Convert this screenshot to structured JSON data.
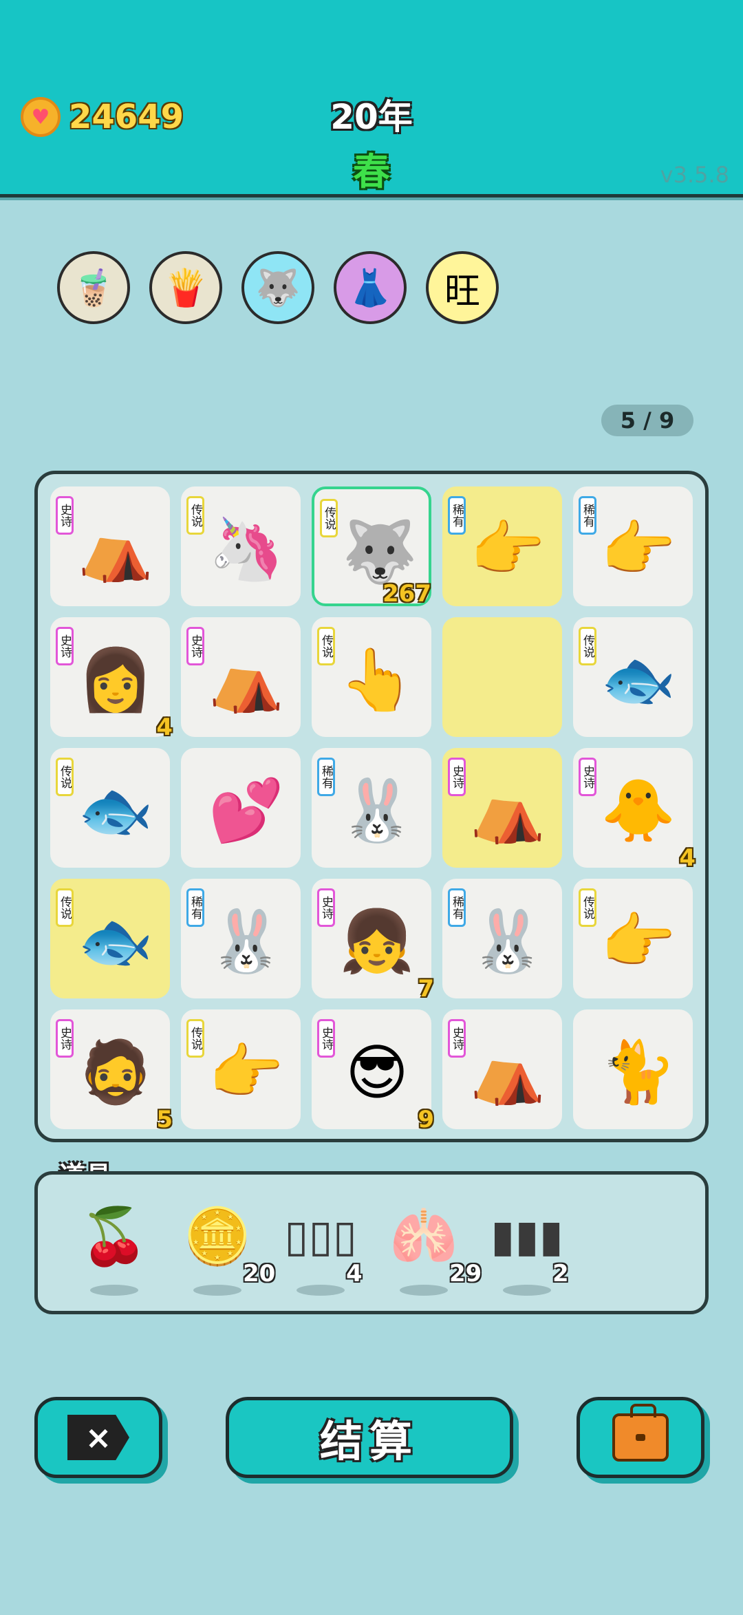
{
  "header": {
    "coins": "24649",
    "year": "20年",
    "season": "春",
    "version": "v3.5.8"
  },
  "slots": [
    {
      "icon": "🧋",
      "bg": "#e9e4cf"
    },
    {
      "icon": "🍟",
      "bg": "#e9e4cf"
    },
    {
      "icon": "🐺",
      "bg": "#8fe5f5"
    },
    {
      "icon": "👗",
      "bg": "#d89be7"
    },
    {
      "icon": "旺",
      "bg": "#fff59a"
    }
  ],
  "progress": "5 / 9",
  "board": [
    [
      {
        "tag": "史诗",
        "rarity": "epic",
        "icon": "⛺",
        "count": ""
      },
      {
        "tag": "传说",
        "rarity": "legend",
        "icon": "🦄",
        "count": ""
      },
      {
        "tag": "传说",
        "rarity": "legend",
        "icon": "🐺",
        "count": "267",
        "selected": true
      },
      {
        "tag": "稀有",
        "rarity": "rare",
        "icon": "👉",
        "count": "",
        "yellow": true
      },
      {
        "tag": "稀有",
        "rarity": "rare",
        "icon": "👉",
        "count": ""
      }
    ],
    [
      {
        "tag": "史诗",
        "rarity": "epic",
        "icon": "👩",
        "count": "4"
      },
      {
        "tag": "史诗",
        "rarity": "epic",
        "icon": "⛺",
        "count": ""
      },
      {
        "tag": "传说",
        "rarity": "legend",
        "icon": "👆",
        "count": ""
      },
      {
        "tag": "",
        "rarity": "",
        "icon": "",
        "count": "",
        "yellow": true
      },
      {
        "tag": "传说",
        "rarity": "legend",
        "icon": "🐟",
        "count": ""
      }
    ],
    [
      {
        "tag": "传说",
        "rarity": "legend",
        "icon": "🐟",
        "count": ""
      },
      {
        "tag": "",
        "rarity": "",
        "icon": "💕",
        "count": ""
      },
      {
        "tag": "稀有",
        "rarity": "rare",
        "icon": "🐰",
        "count": ""
      },
      {
        "tag": "史诗",
        "rarity": "epic",
        "icon": "⛺",
        "count": "",
        "yellow": true
      },
      {
        "tag": "史诗",
        "rarity": "epic",
        "icon": "🐥",
        "count": "4"
      }
    ],
    [
      {
        "tag": "传说",
        "rarity": "legend",
        "icon": "🐟",
        "count": "",
        "yellow": true
      },
      {
        "tag": "稀有",
        "rarity": "rare",
        "icon": "🐰",
        "count": ""
      },
      {
        "tag": "史诗",
        "rarity": "epic",
        "icon": "👧",
        "count": "7"
      },
      {
        "tag": "稀有",
        "rarity": "rare",
        "icon": "🐰",
        "count": ""
      },
      {
        "tag": "传说",
        "rarity": "legend",
        "icon": "👉",
        "count": ""
      }
    ],
    [
      {
        "tag": "史诗",
        "rarity": "epic",
        "icon": "🧔",
        "count": "5"
      },
      {
        "tag": "传说",
        "rarity": "legend",
        "icon": "👉",
        "count": ""
      },
      {
        "tag": "史诗",
        "rarity": "epic",
        "icon": "😎",
        "count": "9"
      },
      {
        "tag": "史诗",
        "rarity": "epic",
        "icon": "⛺",
        "count": ""
      },
      {
        "tag": "",
        "rarity": "",
        "icon": "🐈",
        "count": ""
      }
    ]
  ],
  "tools": {
    "label": "道具",
    "items": [
      {
        "name": "lychee",
        "icon": "🍒",
        "count": ""
      },
      {
        "name": "coin",
        "icon": "🪙",
        "count": "20"
      },
      {
        "name": "slots",
        "icon": "▯▯▯",
        "count": "4"
      },
      {
        "name": "liver",
        "icon": "🫁",
        "count": "29"
      },
      {
        "name": "rare-slots",
        "icon": "▮▮▮",
        "count": "2"
      }
    ]
  },
  "buttons": {
    "exit": "×",
    "settle": "结算"
  }
}
